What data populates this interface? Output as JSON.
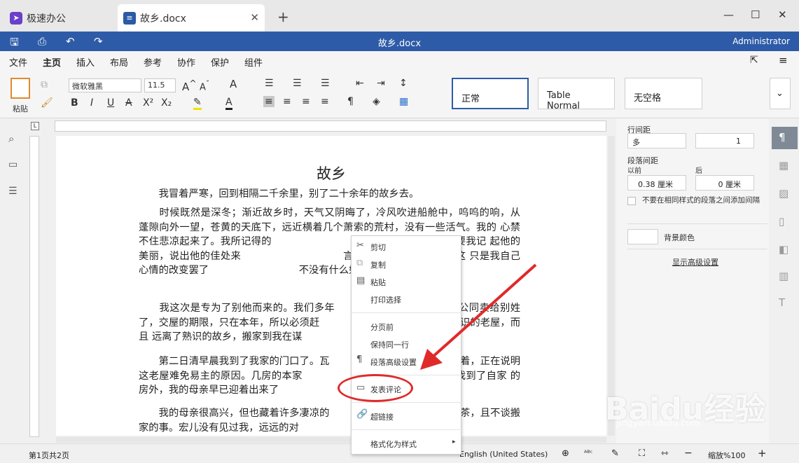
{
  "tabs": [
    {
      "label": "极速办公"
    },
    {
      "label": "故乡.docx"
    }
  ],
  "window_controls": {
    "minimize": "—",
    "maximize": "☐",
    "close": "✕"
  },
  "titlebar": {
    "doc_title": "故乡.docx",
    "user": "Administrator"
  },
  "menu": [
    "文件",
    "主页",
    "插入",
    "布局",
    "参考",
    "协作",
    "保护",
    "组件"
  ],
  "ribbon": {
    "paste_label": "粘贴",
    "font": "微软雅黑",
    "font_size": "11.5",
    "styles": [
      "正常",
      "Table Normal",
      "无空格"
    ]
  },
  "document": {
    "title": "故乡",
    "paragraphs": [
      "　　我冒着严寒，回到相隔二千余里，别了二十余年的故乡去。",
      "　　时候既然是深冬；渐近故乡时，天气又阴晦了，冷风吹进船舱中，呜呜的响，从 蓬隙向外一望，苍黄的天底下，远近横着几个萧索的荒村，没有一些活气。我的 心禁不住悲凉起来了。我所记得的　　　　　　　　　　　乡好得多了。但要我记 起他的美丽，说出他的佳处来　　　　　　　　　　言辞了。仿佛也就如此。这 只是我自己心情的改变罢了　　　　　　　　　不没有什么好心绪。",
      "　　我这次是专为了别他而来的。我们多年　　　　　　　　　　已经公同卖给别姓了，交屋的期限，只在本年，所以必须赶　　　　　　　　　　　　了熟识的老屋，而且 远离了熟识的故乡，搬家到我在谋",
      "　　第二日清早晨我到了我家的门口了。瓦　　　　　　　　　　　风抖着，正在说明 这老屋难免易主的原因。几房的本家　　　　　　　　　　　很寂静。我到了自家 的房外，我的母亲早已迎着出来了　　　　　　　　　　　的侄儿宏儿。",
      "　　我的母亲很高兴，但也藏着许多凄凉的　　　　　　　　　　　，喝茶，且不谈搬 家的事。宏儿没有见过我，远远的对"
    ]
  },
  "context_menu": {
    "items": [
      "剪切",
      "复制",
      "粘贴",
      "打印选择",
      "分页前",
      "保持同一行",
      "段落高级设置",
      "发表评论",
      "超链接",
      "格式化为样式"
    ]
  },
  "right_panel": {
    "line_spacing_label": "行间距",
    "line_spacing_mode": "多",
    "line_spacing_value": "1",
    "para_spacing_label": "段落间距",
    "before_label": "以前",
    "after_label": "后",
    "before_value": "0.38 厘米",
    "after_value": "0 厘米",
    "no_space_checkbox": "不要在相同样式的段落之间添加间隔",
    "bg_color_label": "背景颜色",
    "advanced_link": "显示高级设置"
  },
  "statusbar": {
    "page_info": "第1页共2页",
    "language": "English (United States)",
    "zoom": "缩放%100"
  },
  "watermark": {
    "brand": "Baidu经验",
    "url": "jingyan.baidu.com"
  },
  "colors": {
    "accent": "#2d5ba8",
    "highlight": "#e02a2a"
  }
}
